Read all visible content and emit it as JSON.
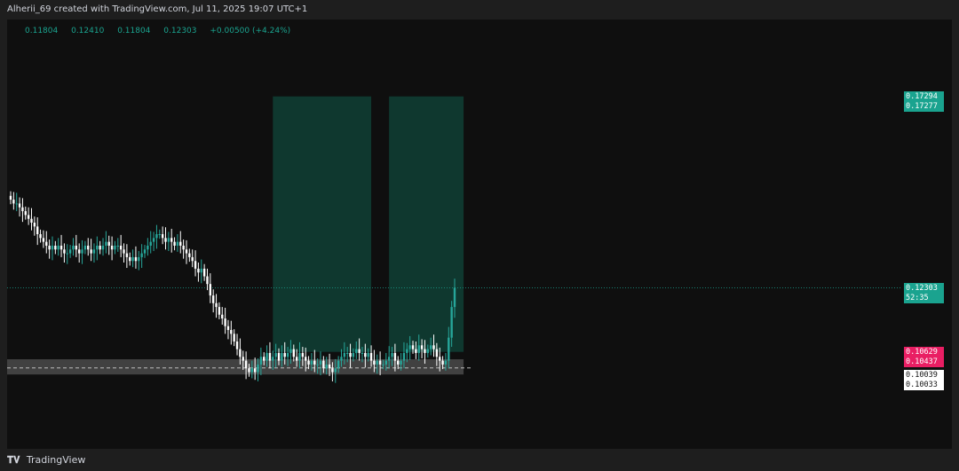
{
  "header": {
    "credit": "Alherii_69 created with TradingView.com, Jul 11, 2025 19:07 UTC+1"
  },
  "legend": {
    "symbol": "",
    "open": "0.11804",
    "high": "0.12410",
    "low": "0.11804",
    "close": "0.12303",
    "change": "+0.00500 (+4.24%)"
  },
  "footer": {
    "brand": "TradingView"
  },
  "colors": {
    "up": "#26a69a",
    "down": "#ffffff",
    "target_zone": "#0f3d33",
    "stop_zone": "#4a4a4a",
    "pink": "#e91e63",
    "bg": "#0f0f0f"
  },
  "price_tags": [
    {
      "label": "0.17294",
      "price": 0.17294,
      "bg": "#1aa38f",
      "fg": "#ffffff"
    },
    {
      "label": "0.17277",
      "price": 0.17277,
      "bg": "#1aa38f",
      "fg": "#ffffff"
    },
    {
      "label": "0.12303",
      "price": 0.12303,
      "bg": "#1aa38f",
      "fg": "#ffffff"
    },
    {
      "label": "52:35",
      "price": 0.12303,
      "bg": "#1aa38f",
      "fg": "#ffffff"
    },
    {
      "label": "0.10629",
      "price": 0.10629,
      "bg": "#e91e63",
      "fg": "#ffffff"
    },
    {
      "label": "0.10437",
      "price": 0.10437,
      "bg": "#e91e63",
      "fg": "#ffffff"
    },
    {
      "label": "0.10039",
      "price": 0.10039,
      "bg": "#ffffff",
      "fg": "#111111"
    },
    {
      "label": "0.10033",
      "price": 0.10033,
      "bg": "#ffffff",
      "fg": "#111111"
    }
  ],
  "chart_data": {
    "type": "candlestick",
    "ylim": [
      0.081,
      0.193
    ],
    "current_price": 0.12303,
    "close_series": [
      0.146,
      0.145,
      0.145,
      0.144,
      0.143,
      0.142,
      0.141,
      0.14,
      0.139,
      0.137,
      0.136,
      0.135,
      0.134,
      0.133,
      0.134,
      0.133,
      0.134,
      0.133,
      0.132,
      0.132,
      0.133,
      0.134,
      0.133,
      0.132,
      0.133,
      0.134,
      0.133,
      0.132,
      0.133,
      0.134,
      0.133,
      0.134,
      0.135,
      0.134,
      0.133,
      0.134,
      0.134,
      0.133,
      0.132,
      0.131,
      0.13,
      0.131,
      0.13,
      0.131,
      0.132,
      0.133,
      0.134,
      0.135,
      0.136,
      0.137,
      0.137,
      0.136,
      0.135,
      0.136,
      0.135,
      0.134,
      0.135,
      0.134,
      0.133,
      0.132,
      0.131,
      0.13,
      0.128,
      0.127,
      0.128,
      0.126,
      0.124,
      0.121,
      0.119,
      0.118,
      0.116,
      0.115,
      0.113,
      0.112,
      0.111,
      0.109,
      0.107,
      0.105,
      0.104,
      0.102,
      0.101,
      0.102,
      0.101,
      0.103,
      0.105,
      0.104,
      0.106,
      0.104,
      0.105,
      0.106,
      0.104,
      0.106,
      0.105,
      0.106,
      0.107,
      0.105,
      0.104,
      0.106,
      0.105,
      0.104,
      0.103,
      0.104,
      0.103,
      0.103,
      0.104,
      0.102,
      0.103,
      0.102,
      0.101,
      0.102,
      0.104,
      0.105,
      0.106,
      0.106,
      0.105,
      0.106,
      0.107,
      0.106,
      0.106,
      0.105,
      0.106,
      0.104,
      0.103,
      0.104,
      0.103,
      0.103,
      0.104,
      0.105,
      0.106,
      0.104,
      0.103,
      0.104,
      0.106,
      0.107,
      0.108,
      0.107,
      0.106,
      0.108,
      0.107,
      0.106,
      0.107,
      0.108,
      0.107,
      0.105,
      0.104,
      0.103,
      0.104,
      0.11,
      0.118,
      0.123
    ],
    "x_domain_candles": [
      0,
      149
    ],
    "zones": [
      {
        "kind": "target",
        "x_start": 88,
        "x_end": 121,
        "y_top": 0.17294,
        "y_bottom": 0.10629
      },
      {
        "kind": "target",
        "x_start": 127,
        "x_end": 152,
        "y_top": 0.17294,
        "y_bottom": 0.10629
      },
      {
        "kind": "stop",
        "x_start": -2,
        "x_end": 152,
        "y_top": 0.10437,
        "y_bottom": 0.10039
      }
    ]
  }
}
